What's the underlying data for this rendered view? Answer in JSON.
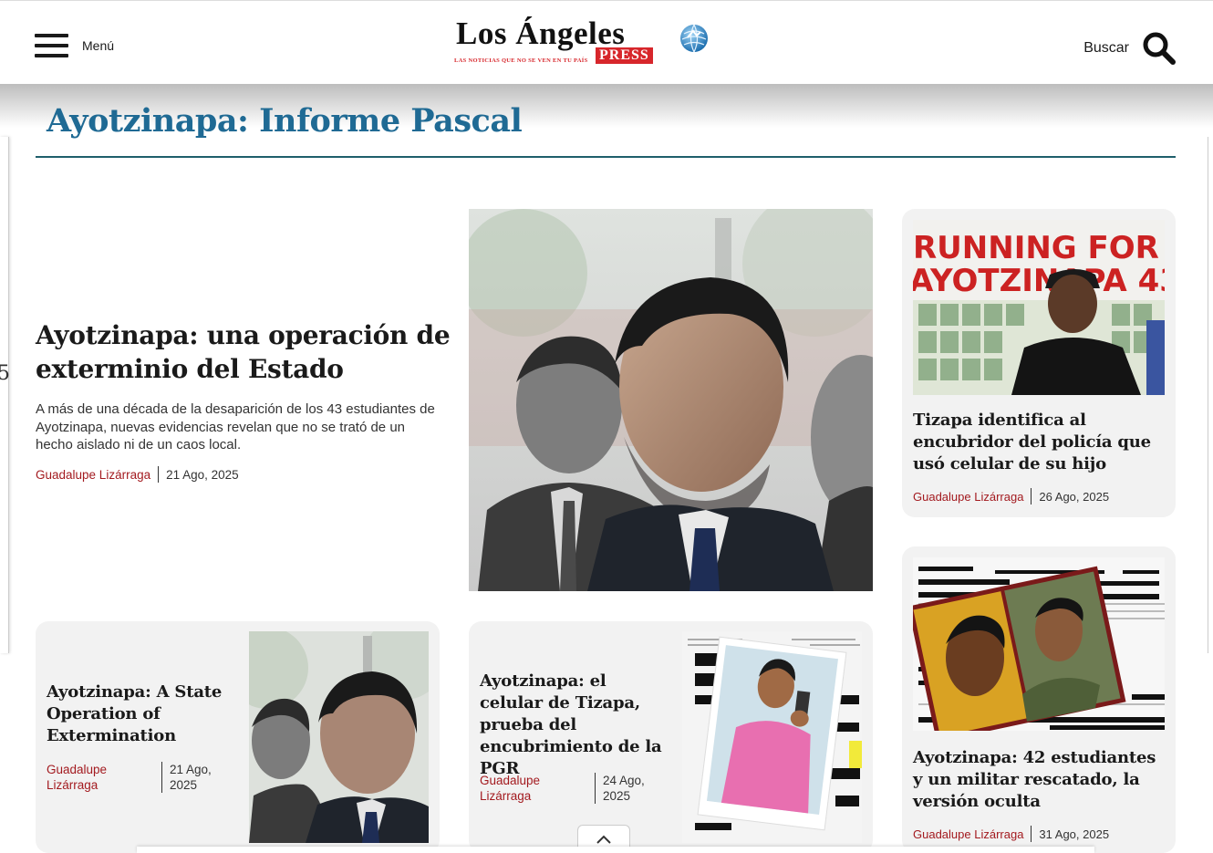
{
  "header": {
    "menu_label": "Menú",
    "logo_name": "Los Ángeles",
    "logo_press": "PRESS",
    "logo_tagline": "LAS NOTICIAS QUE NO SE VEN EN TU PAÍS",
    "search_label": "Buscar"
  },
  "section": {
    "title": "Ayotzinapa: Informe Pascal"
  },
  "featured": {
    "title": "Ayotzinapa: una operación de exterminio del Estado",
    "excerpt": "A más de una década de la desaparición de los 43 estudiantes de Ayotzinapa, nuevas evidencias revelan que no se trató de un hecho aislado ni de un caos local.",
    "author": "Guadalupe Lizárraga",
    "date": "21 Ago, 2025"
  },
  "cards": [
    {
      "title": "Tizapa identifica al encubridor del policía que usó celular de su hijo",
      "author": "Guadalupe Lizárraga",
      "date": "26 Ago, 2025",
      "image_text_1": "RUNNING FOR",
      "image_text_2": "AYOTZINAPA 43"
    },
    {
      "title": "Ayotzinapa: 42 estudiantes y un militar rescatado, la versión oculta",
      "author": "Guadalupe Lizárraga",
      "date": "31 Ago, 2025"
    },
    {
      "title": "Ayotzinapa: A State Operation of Extermination",
      "author_line1": "Guadalupe",
      "author_line2": "Lizárraga",
      "date_line1": "21 Ago,",
      "date_line2": "2025"
    },
    {
      "title": "Ayotzinapa: el celular de Tizapa, prueba del encubrimiento de la PGR",
      "author_line1": "Guadalupe",
      "author_line2": "Lizárraga",
      "date_line1": "24 Ago,",
      "date_line2": "2025"
    }
  ],
  "colors": {
    "accent_blue": "#1f6a94",
    "author_red": "#a31a1f",
    "logo_red": "#d7262b",
    "card_bg": "#f2f2f2"
  },
  "icons": {
    "menu": "hamburger-icon",
    "search": "search-icon",
    "scroll_top": "chevron-up-icon",
    "globe": "globe-icon"
  }
}
